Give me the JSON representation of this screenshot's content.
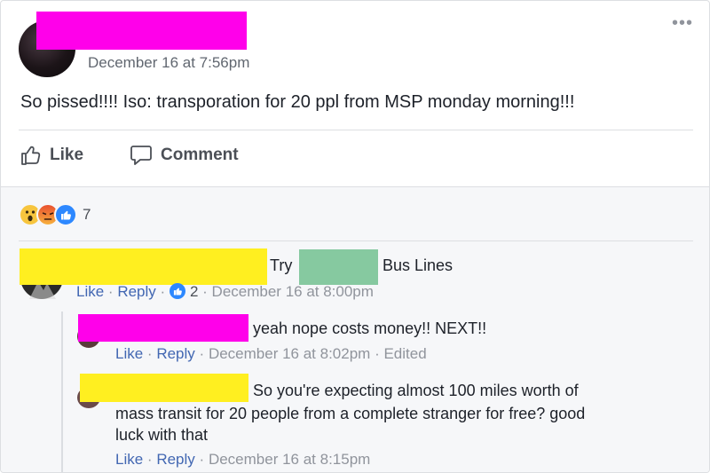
{
  "post": {
    "timestamp": "December 16 at 7:56pm",
    "text": "So pissed!!!! Iso: transporation for 20 ppl from MSP monday morning!!!",
    "more_label": "•••"
  },
  "actions": {
    "like_label": "Like",
    "comment_label": "Comment"
  },
  "reactions": {
    "count": "7",
    "types": [
      "wow-icon",
      "angry-icon",
      "like-icon"
    ]
  },
  "comments": [
    {
      "text_prefix": "Try",
      "text_suffix": "Bus Lines",
      "like": "Like",
      "reply": "Reply",
      "reaction_count": "2",
      "time": "December 16 at 8:00pm"
    }
  ],
  "replies": [
    {
      "text": "yeah nope costs money!! NEXT!!",
      "like": "Like",
      "reply": "Reply",
      "time": "December 16 at 8:02pm",
      "edited": "Edited"
    },
    {
      "line1": "So you're expecting almost 100 miles worth of",
      "line2": "mass transit for 20 people from a complete stranger for free? good",
      "line3": "luck with that",
      "like": "Like",
      "reply": "Reply",
      "time": "December 16 at 8:15pm"
    }
  ],
  "sep": "·",
  "colors": {
    "link": "#4267b2",
    "redact_pink": "#ff00ea",
    "redact_yellow": "#ffef20",
    "redact_green": "#86c9a0"
  }
}
